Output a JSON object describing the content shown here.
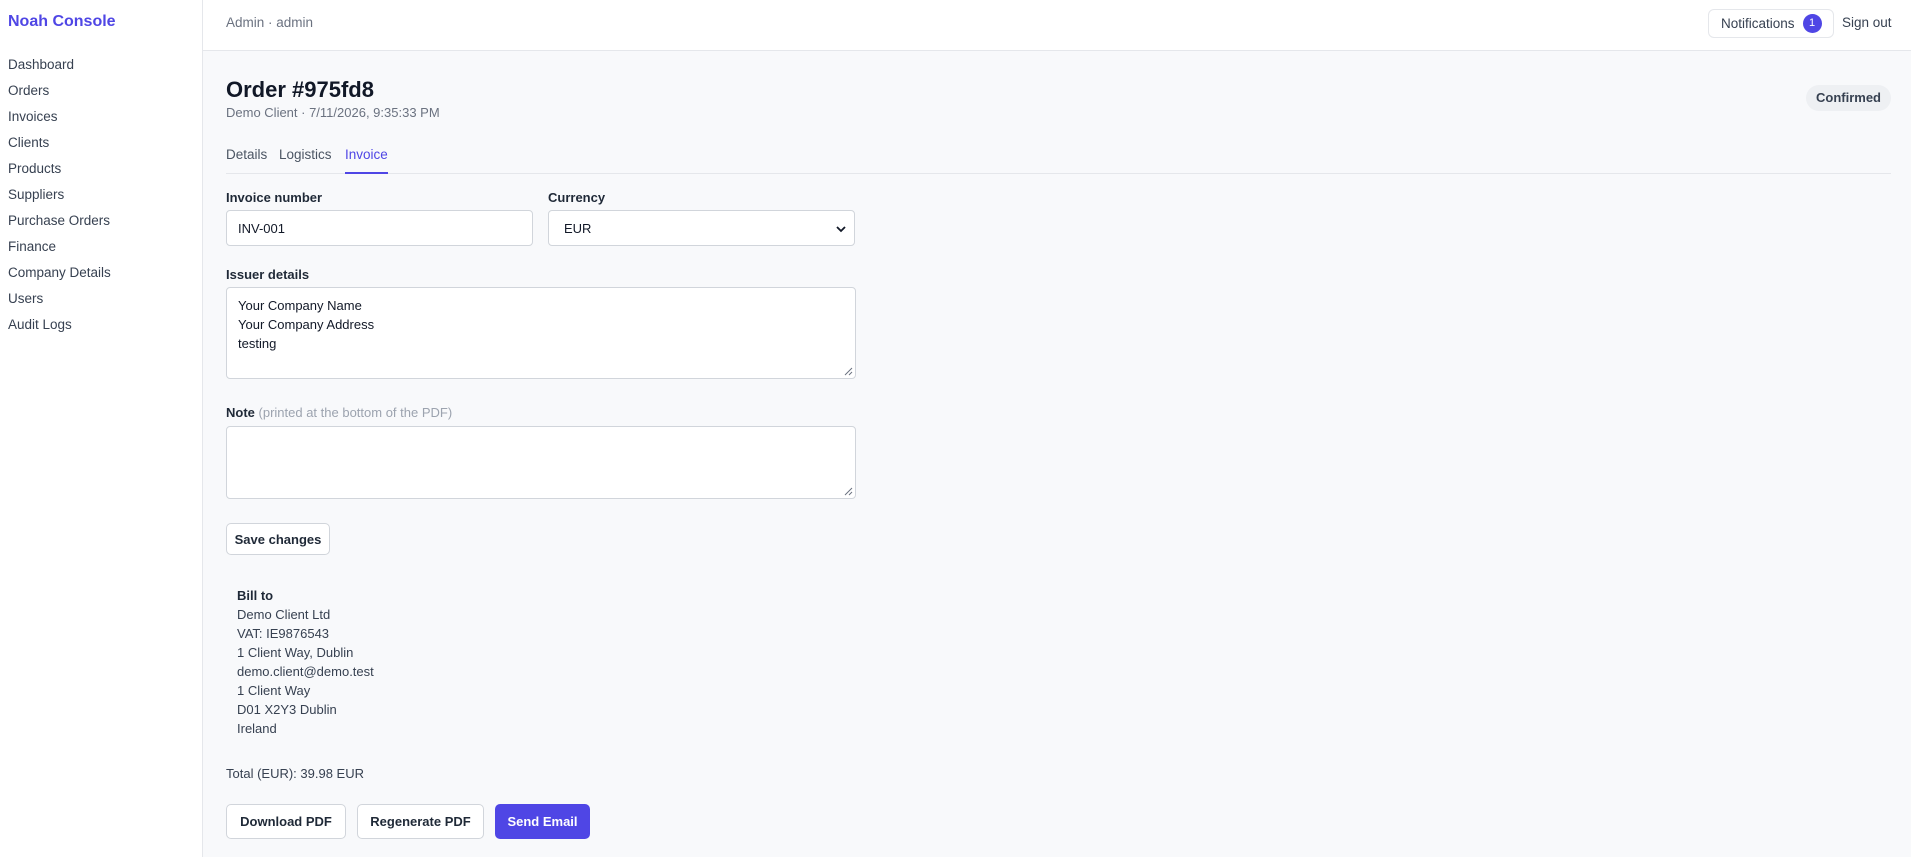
{
  "sidebar": {
    "brand": "Noah Console",
    "items": [
      {
        "label": "Dashboard"
      },
      {
        "label": "Orders"
      },
      {
        "label": "Invoices"
      },
      {
        "label": "Clients"
      },
      {
        "label": "Products"
      },
      {
        "label": "Suppliers"
      },
      {
        "label": "Purchase Orders"
      },
      {
        "label": "Finance"
      },
      {
        "label": "Company Details"
      },
      {
        "label": "Users"
      },
      {
        "label": "Audit Logs"
      }
    ]
  },
  "header": {
    "crumb": "Admin · admin",
    "notifications_label": "Notifications",
    "notifications_count": "1",
    "signout": "Sign out"
  },
  "order": {
    "title": "Order #975fd8",
    "subtitle": "Demo Client · 7/11/2026, 9:35:33 PM",
    "status": "Confirmed"
  },
  "tabs": [
    {
      "label": "Details"
    },
    {
      "label": "Logistics"
    },
    {
      "label": "Invoice"
    }
  ],
  "form": {
    "invoice_number_label": "Invoice number",
    "invoice_number_value": "INV-001",
    "currency_label": "Currency",
    "currency_value": "EUR",
    "issuer_label": "Issuer details",
    "issuer_value": "Your Company Name\nYour Company Address\ntesting",
    "note_label": "Note",
    "note_hint": "(printed at the bottom of the PDF)",
    "note_value": "",
    "save_label": "Save changes"
  },
  "bill_to": {
    "title": "Bill to",
    "lines": [
      "Demo Client Ltd",
      "VAT: IE9876543",
      "1 Client Way, Dublin",
      "demo.client@demo.test",
      "1 Client Way",
      "D01 X2Y3 Dublin",
      "Ireland"
    ]
  },
  "total": "Total (EUR): 39.98 EUR",
  "actions": {
    "download": "Download PDF",
    "regenerate": "Regenerate PDF",
    "send": "Send Email"
  },
  "colors": {
    "accent": "#4f46e5",
    "background": "#f8f9fb",
    "border": "#e5e7eb"
  }
}
